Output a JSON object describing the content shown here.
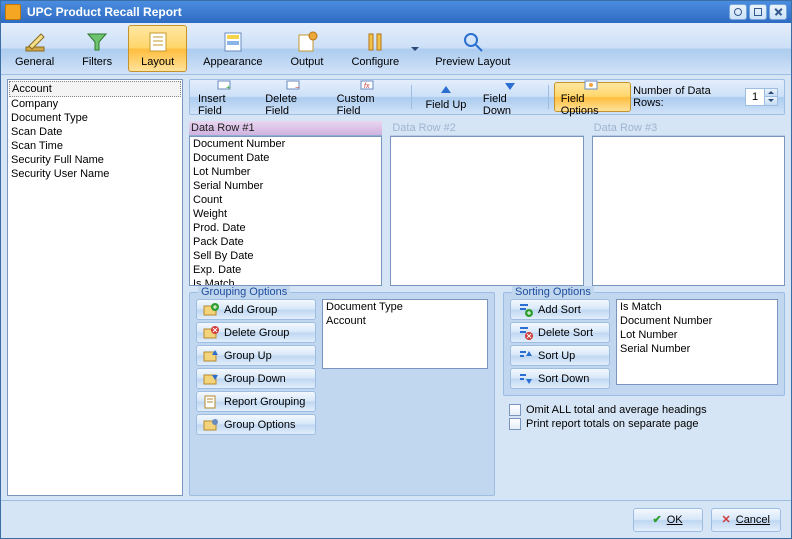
{
  "window": {
    "title": "UPC Product Recall Report"
  },
  "main_tabs": {
    "items": [
      {
        "label": "General",
        "icon": "pencil"
      },
      {
        "label": "Filters",
        "icon": "funnel"
      },
      {
        "label": "Layout",
        "icon": "layout",
        "selected": true
      },
      {
        "label": "Appearance",
        "icon": "appearance"
      },
      {
        "label": "Output",
        "icon": "output"
      },
      {
        "label": "Configure",
        "icon": "configure",
        "dropdown": true
      },
      {
        "label": "Preview Layout",
        "icon": "preview"
      }
    ]
  },
  "available_fields": [
    "Account",
    "Company",
    "Document Type",
    "Scan Date",
    "Scan Time",
    "Security Full Name",
    "Security User Name"
  ],
  "layout_toolbar": {
    "items": [
      {
        "label": "Insert Field",
        "icon": "insert"
      },
      {
        "label": "Delete Field",
        "icon": "delete"
      },
      {
        "label": "Custom Field",
        "icon": "custom"
      },
      {
        "sep": true
      },
      {
        "label": "Field Up",
        "icon": "up"
      },
      {
        "label": "Field Down",
        "icon": "down"
      },
      {
        "sep": true
      },
      {
        "label": "Field Options",
        "icon": "options",
        "selected": true
      }
    ],
    "rows_label": "Number of Data Rows:",
    "rows_value": "1"
  },
  "data_rows": [
    {
      "title": "Data Row #1",
      "active": true,
      "items": [
        "Document Number",
        "Document Date",
        "Lot Number",
        "Serial Number",
        "Count",
        "Weight",
        "Prod. Date",
        "Pack Date",
        "Sell By Date",
        "Exp. Date",
        "Is Match"
      ]
    },
    {
      "title": "Data Row #2",
      "active": false,
      "items": []
    },
    {
      "title": "Data Row #3",
      "active": false,
      "items": []
    }
  ],
  "grouping": {
    "title": "Grouping Options",
    "actions": [
      "Add Group",
      "Delete Group",
      "Group Up",
      "Group Down",
      "Report Grouping",
      "Group Options"
    ],
    "items": [
      "Document Type",
      "Account"
    ]
  },
  "sorting": {
    "title": "Sorting Options",
    "actions": [
      "Add Sort",
      "Delete Sort",
      "Sort Up",
      "Sort Down"
    ],
    "items": [
      "Is Match",
      "Document Number",
      "Lot Number",
      "Serial Number"
    ]
  },
  "options": {
    "omit_headings": "Omit ALL total and average headings",
    "print_totals": "Print report totals on separate page"
  },
  "buttons": {
    "ok": "OK",
    "cancel": "Cancel"
  },
  "icons": {
    "add": "#2e9e2e",
    "del": "#d23b3b",
    "up": "#2b6fd1",
    "down": "#2b6fd1"
  }
}
